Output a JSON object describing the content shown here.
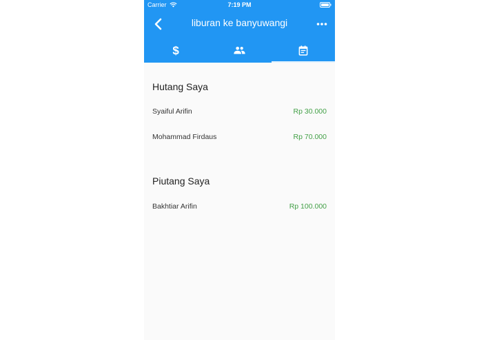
{
  "status_bar": {
    "carrier": "Carrier",
    "time": "7:19 PM"
  },
  "header": {
    "title": "liburan ke banyuwangi"
  },
  "tabs": [
    {
      "icon": "dollar-icon",
      "glyph": "$"
    },
    {
      "icon": "people-icon"
    },
    {
      "icon": "event-note-icon"
    }
  ],
  "colors": {
    "primary": "#2196f3",
    "amount": "#43a047"
  },
  "debts": {
    "title": "Hutang Saya",
    "items": [
      {
        "name": "Syaiful Arifin",
        "amount": "Rp 30.000"
      },
      {
        "name": "Mohammad Firdaus",
        "amount": "Rp 70.000"
      }
    ]
  },
  "receivables": {
    "title": "Piutang Saya",
    "items": [
      {
        "name": "Bakhtiar Arifin",
        "amount": "Rp 100.000"
      }
    ]
  }
}
